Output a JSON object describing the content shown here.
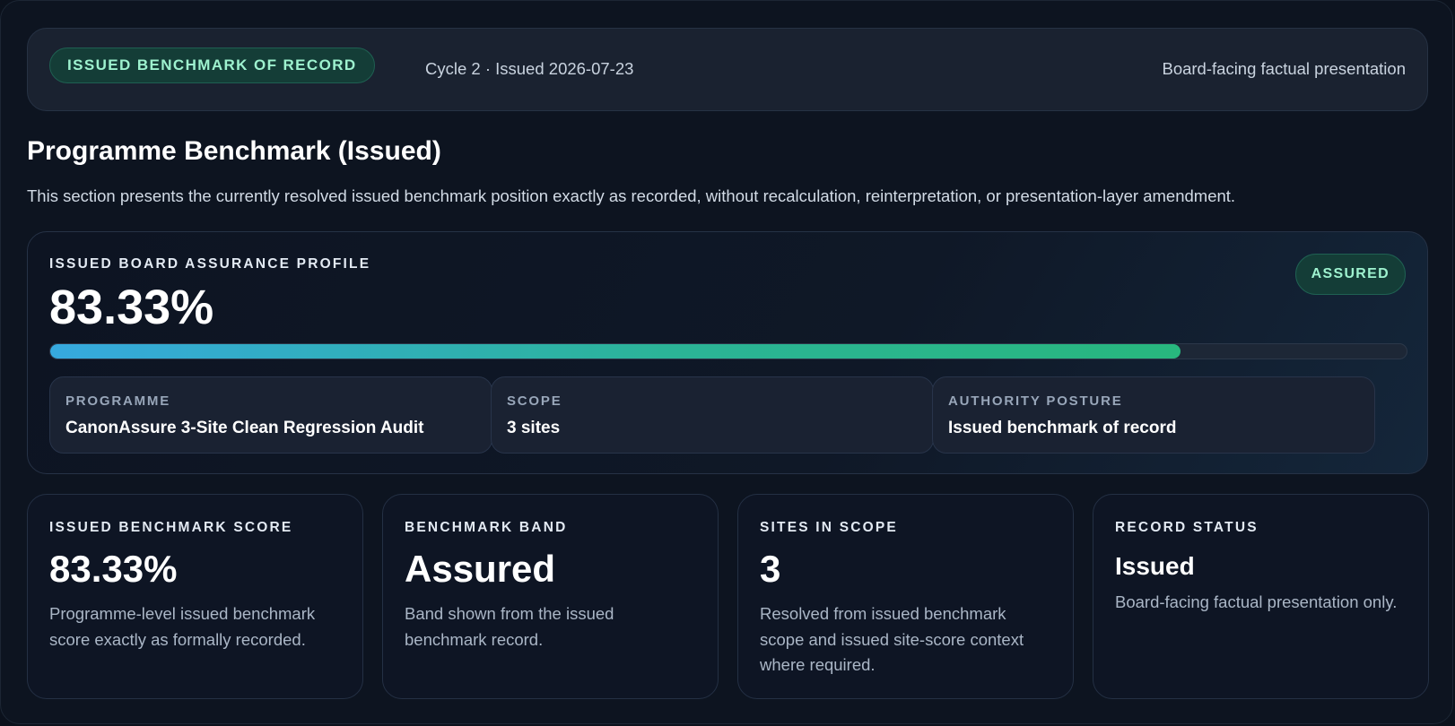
{
  "header": {
    "record_badge": "ISSUED BENCHMARK OF RECORD",
    "cycle_info": "Cycle 2 · Issued 2026-07-23",
    "presentation_note": "Board-facing factual presentation"
  },
  "section": {
    "title": "Programme Benchmark (Issued)",
    "description": "This section presents the currently resolved issued benchmark position exactly as recorded, without recalculation, reinterpretation, or presentation-layer amendment."
  },
  "profile": {
    "label": "ISSUED BOARD ASSURANCE PROFILE",
    "value": "83.33%",
    "progress_percent": 83.33,
    "status_badge": "ASSURED",
    "details": [
      {
        "label": "PROGRAMME",
        "value": "CanonAssure 3-Site Clean Regression Audit"
      },
      {
        "label": "SCOPE",
        "value": "3 sites"
      },
      {
        "label": "AUTHORITY POSTURE",
        "value": "Issued benchmark of record"
      }
    ]
  },
  "stats": [
    {
      "label": "ISSUED BENCHMARK SCORE",
      "value": "83.33%",
      "description": "Programme-level issued benchmark score exactly as formally recorded."
    },
    {
      "label": "BENCHMARK BAND",
      "value": "Assured",
      "description": "Band shown from the issued benchmark record."
    },
    {
      "label": "SITES IN SCOPE",
      "value": "3",
      "description": "Resolved from issued benchmark scope and issued site-score context where required."
    },
    {
      "label": "RECORD STATUS",
      "value": "Issued",
      "description": "Board-facing factual presentation only."
    }
  ],
  "colors": {
    "accent_green": "#9ef2cf",
    "progress_start": "#36a9df",
    "progress_end": "#28b77e",
    "background": "#0d1420"
  }
}
